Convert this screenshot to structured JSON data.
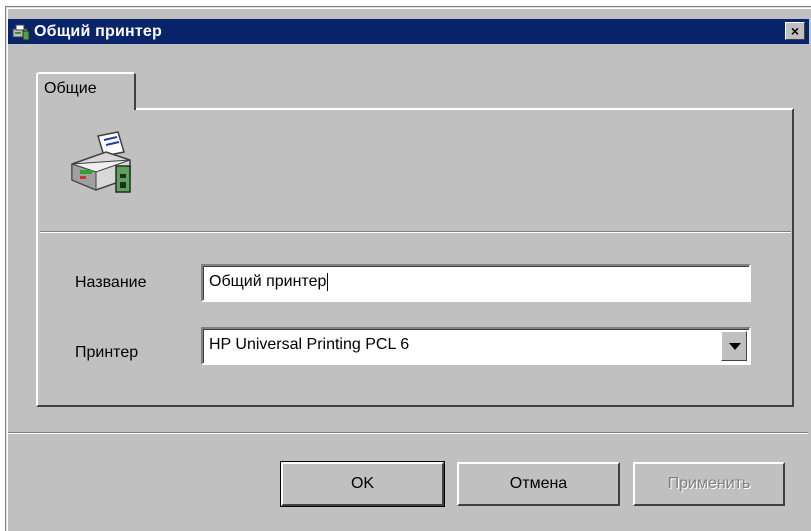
{
  "window": {
    "title": "Общий принтер",
    "close_label": "×"
  },
  "tabs": [
    {
      "label": "Общие",
      "selected": true
    }
  ],
  "form": {
    "name_label": "Название",
    "name_value": "Общий принтер",
    "printer_label": "Принтер",
    "printer_value": "HP Universal Printing PCL 6"
  },
  "buttons": {
    "ok": "OK",
    "cancel": "Отмена",
    "apply": "Применить",
    "apply_enabled": false
  },
  "icons": {
    "app": "printer-app-icon",
    "printer": "printer-icon",
    "dropdown": "chevron-down-icon"
  },
  "colors": {
    "titlebar": "#08246b",
    "face": "#c0c0c0",
    "disabled_text": "#808080"
  }
}
